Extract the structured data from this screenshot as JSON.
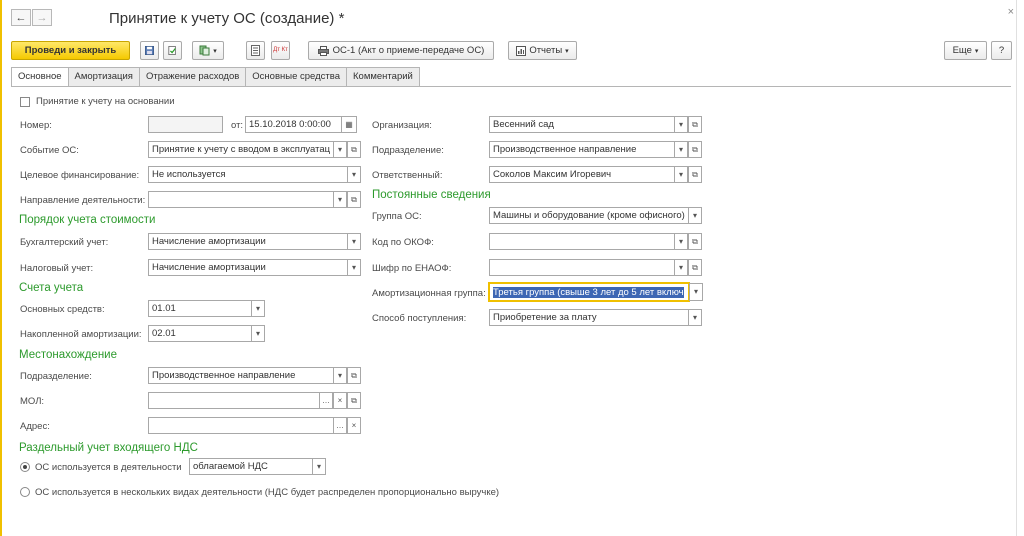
{
  "window": {
    "title": "Принятие к учету ОС (создание) *",
    "close": "×"
  },
  "nav": {
    "back": "←",
    "forward": "→"
  },
  "toolbar": {
    "post_close": "Проведи и закрыть",
    "os1": "ОС-1 (Акт о приеме-передаче ОС)",
    "reports": "Отчеты",
    "more": "Еще",
    "help": "?",
    "dt_kt": "Дт Кт"
  },
  "tabs": [
    "Основное",
    "Амортизация",
    "Отражение расходов",
    "Основные средства",
    "Комментарий"
  ],
  "based_on": "Принятие к учету на основании",
  "left": {
    "number_label": "Номер:",
    "number_value": "",
    "date_label": "от:",
    "date_value": "15.10.2018  0:00:00",
    "event_label": "Событие ОС:",
    "event_value": "Принятие к учету с вводом в эксплуатац",
    "target_label": "Целевое финансирование:",
    "target_value": "Не используется",
    "direction_label": "Направление деятельности:",
    "direction_value": "",
    "sect_cost": "Порядок учета стоимости",
    "acc_label": "Бухгалтерский учет:",
    "acc_value": "Начисление амортизации",
    "tax_label": "Налоговый учет:",
    "tax_value": "Начисление амортизации",
    "sect_accounts": "Счета учета",
    "fixed_label": "Основных средств:",
    "fixed_value": "01.01",
    "dep_label": "Накопленной амортизации:",
    "dep_value": "02.01",
    "sect_location": "Местонахождение",
    "div_label": "Подразделение:",
    "div_value": "Производственное направление",
    "mol_label": "МОЛ:",
    "mol_value": "",
    "addr_label": "Адрес:",
    "addr_value": "",
    "sect_vat": "Раздельный учет входящего НДС",
    "radio1": "ОС используется в деятельности",
    "radio1_value": "облагаемой НДС",
    "radio2": "ОС используется в нескольких видах деятельности (НДС будет распределен пропорционально выручке)"
  },
  "right": {
    "org_label": "Организация:",
    "org_value": "Весенний сад",
    "div_label": "Подразделение:",
    "div_value": "Производственное направление",
    "resp_label": "Ответственный:",
    "resp_value": "Соколов Максим Игоревич",
    "sect_const": "Постоянные сведения",
    "group_label": "Группа ОС:",
    "group_value": "Машины и оборудование (кроме офисного)",
    "okof_label": "Код по ОКОФ:",
    "okof_value": "",
    "enaof_label": "Шифр по ЕНАОФ:",
    "enaof_value": "",
    "amgroup_label": "Амортизационная группа:",
    "amgroup_value": "Третья группа (свыше 3 лет до 5 лет включ",
    "receipt_label": "Способ поступления:",
    "receipt_value": "Приобретение за плату"
  }
}
